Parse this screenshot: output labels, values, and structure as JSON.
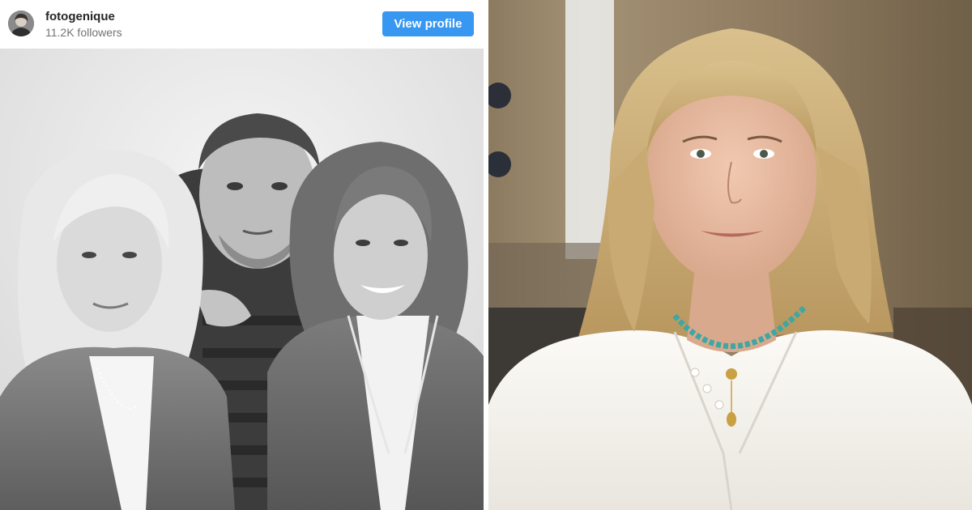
{
  "post": {
    "username": "fotogenique",
    "followers": "11.2K followers",
    "view_profile_label": "View profile",
    "button_color": "#3897f0",
    "avatar": "profile-avatar"
  },
  "photos": {
    "left": "black-and-white-group-portrait",
    "right": "color-portrait"
  }
}
